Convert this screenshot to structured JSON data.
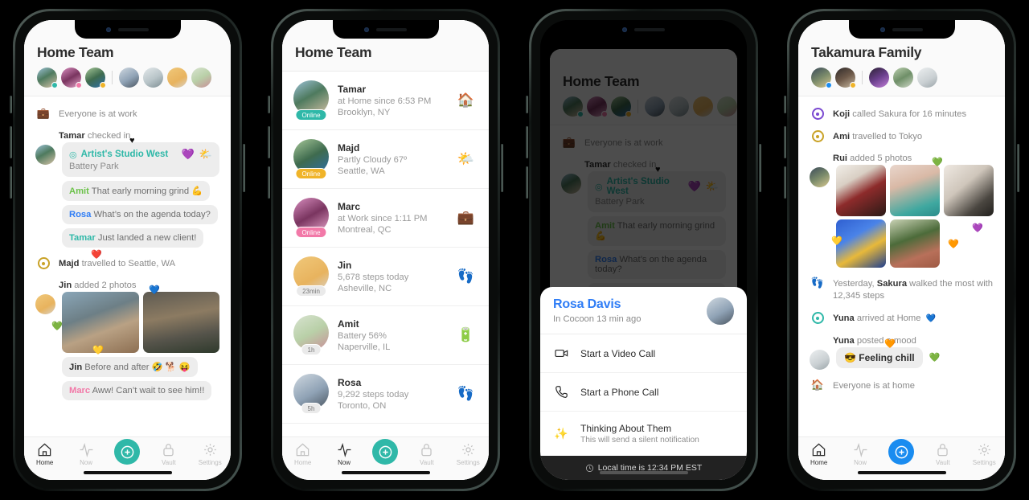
{
  "accent": {
    "teal": "#2fb8a8",
    "blue": "#1a8cf0",
    "yellow": "#f0b429",
    "pink": "#f279a8",
    "purple": "#7b4ad1",
    "green": "#6cc24a"
  },
  "phone1": {
    "header": {
      "title": "Home Team"
    },
    "avatars": [
      {
        "name": "avatar-tamar",
        "dot": "#2fb8a8"
      },
      {
        "name": "avatar-marc",
        "dot": "#f279a8"
      },
      {
        "name": "avatar-majd",
        "dot": "#f0b429"
      },
      {
        "name": "avatar-rosa",
        "dot": ""
      },
      {
        "name": "avatar-amit",
        "dot": ""
      },
      {
        "name": "avatar-jin",
        "dot": ""
      },
      {
        "name": "avatar-yuna",
        "dot": ""
      }
    ],
    "status_work": {
      "icon": "briefcase-emoji",
      "glyph": "💼",
      "text": "Everyone is at work"
    },
    "checkin": {
      "label_name": "Tamar",
      "label_rest": " checked in",
      "place": "Artist's Studio West",
      "sub": "Battery Park",
      "pin_icon": "location-pin-icon",
      "reaction_purple": "💜",
      "weather": "🌤️",
      "heart_black": "♥"
    },
    "messages": [
      {
        "who": "Amit",
        "color": "#6cc24a",
        "text": " That early morning grind 💪"
      },
      {
        "who": "Rosa",
        "color": "#2f7df6",
        "text": " What’s on the agenda today?"
      },
      {
        "who": "Tamar",
        "color": "#2fb8a8",
        "text": " Just landed a new client!"
      }
    ],
    "travel": {
      "who": "Majd",
      "text": " travelled to Seattle, WA",
      "heart": "❤️"
    },
    "photos_label": {
      "who": "Jin",
      "text": " added 2 photos"
    },
    "photo_hearts": {
      "blue": "💙",
      "teal": "💚",
      "yellow": "💛"
    },
    "messages2": [
      {
        "who": "Jin",
        "color": "#2d2d2d",
        "text": " Before and after 🤣 🐕 😝"
      },
      {
        "who": "Marc",
        "color": "#f279a8",
        "text": " Aww! Can’t wait to see him!!"
      }
    ],
    "tabs": [
      {
        "label": "Home",
        "icon": "home-icon",
        "active": true
      },
      {
        "label": "Now",
        "icon": "pulse-icon",
        "active": false
      },
      {
        "label": "",
        "icon": "plus-circle-icon",
        "fab": true,
        "color": "#2fb8a8"
      },
      {
        "label": "Vault",
        "icon": "lock-icon",
        "active": false
      },
      {
        "label": "Settings",
        "icon": "gear-icon",
        "active": false
      }
    ]
  },
  "phone2": {
    "header": {
      "title": "Home Team"
    },
    "rows": [
      {
        "name": "Tamar",
        "line1": "at Home since 6:53 PM",
        "line2": "Brooklyn, NY",
        "badge": "Online",
        "badge_color": "#2fb8a8",
        "emoji": "🏠",
        "emoji_name": "house-emoji",
        "avatar": "av1"
      },
      {
        "name": "Majd",
        "line1": "Partly Cloudy 67º",
        "line2": "Seattle, WA",
        "badge": "Online",
        "badge_color": "#f0b429",
        "emoji": "🌤️",
        "emoji_name": "partly-cloudy-emoji",
        "avatar": "av3"
      },
      {
        "name": "Marc",
        "line1": "at Work since 1:11 PM",
        "line2": "Montreal, QC",
        "badge": "Online",
        "badge_color": "#f279a8",
        "emoji": "💼",
        "emoji_name": "briefcase-emoji",
        "avatar": "av2"
      },
      {
        "name": "Jin",
        "line1": "5,678 steps today",
        "line2": "Asheville, NC",
        "badge": "23min",
        "badge_color": "",
        "emoji": "👣",
        "emoji_name": "footprints-emoji",
        "avatar": "av6"
      },
      {
        "name": "Amit",
        "line1": "Battery 56%",
        "line2": "Naperville, IL",
        "badge": "1h",
        "badge_color": "",
        "emoji": "🔋",
        "emoji_name": "battery-emoji",
        "avatar": "av7"
      },
      {
        "name": "Rosa",
        "line1": "9,292 steps today",
        "line2": "Toronto, ON",
        "badge": "5h",
        "badge_color": "",
        "emoji": "👣",
        "emoji_name": "footprints-emoji",
        "avatar": "av4"
      }
    ],
    "tabs": [
      {
        "label": "Home",
        "icon": "home-icon",
        "active": false
      },
      {
        "label": "Now",
        "icon": "pulse-icon",
        "active": true
      },
      {
        "label": "",
        "icon": "plus-circle-icon",
        "fab": true,
        "color": "#2fb8a8"
      },
      {
        "label": "Vault",
        "icon": "lock-icon",
        "active": false
      },
      {
        "label": "Settings",
        "icon": "gear-icon",
        "active": false
      }
    ]
  },
  "phone3": {
    "background_title": "Home Team",
    "sheet": {
      "name": "Rosa Davis",
      "sub": "In Cocoon 13 min ago",
      "avatar_name": "avatar-rosa",
      "items": [
        {
          "label": "Start a Video Call",
          "note": "",
          "icon": "video-camera-icon"
        },
        {
          "label": "Start a Phone Call",
          "note": "",
          "icon": "phone-icon"
        },
        {
          "label": "Thinking About Them",
          "note": "This will send a silent notification",
          "icon": "sparkles-icon",
          "emoji": "✨"
        }
      ],
      "footer": {
        "icon": "clock-icon",
        "text": "Local time is 12:34 PM EST"
      }
    }
  },
  "phone4": {
    "header": {
      "title": "Takamura Family"
    },
    "avatars": [
      {
        "name": "avatar-rui",
        "dot": "#1a8cf0"
      },
      {
        "name": "avatar-sakura",
        "dot": "#f0b429"
      },
      {
        "name": "avatar-koji",
        "dot": ""
      },
      {
        "name": "avatar-ami",
        "dot": ""
      },
      {
        "name": "avatar-yuna",
        "dot": ""
      }
    ],
    "events": [
      {
        "type": "ring-purple",
        "who": "Koji",
        "text": " called Sakura for 16 minutes",
        "icon": "activity-ring-icon"
      },
      {
        "type": "ring-yellow",
        "who": "Ami",
        "text": " travelled to Tokyo",
        "icon": "activity-ring-icon"
      }
    ],
    "photos_label": {
      "who": "Rui",
      "text": " added 5 photos"
    },
    "photo_hearts": {
      "teal": "💚",
      "purple": "💜",
      "yellow": "💛",
      "orange": "🧡"
    },
    "steps": {
      "icon": "footprints-emoji",
      "glyph": "👣",
      "pre": "Yesterday, ",
      "who": "Sakura",
      "post": " walked the most with 12,345 steps"
    },
    "arrived": {
      "type": "ring-teal",
      "who": "Yuna",
      "text": " arrived at Home",
      "heart": "💙",
      "icon": "activity-ring-icon"
    },
    "mood_label": {
      "who": "Yuna",
      "text": " posted a mood"
    },
    "mood": {
      "emoji": "😎",
      "text": "Feeling chill",
      "heart_teal": "💚",
      "heart_orange": "🧡"
    },
    "home_status": {
      "glyph": "🏠",
      "icon": "house-emoji",
      "text": "Everyone is at home"
    },
    "tabs": [
      {
        "label": "Home",
        "icon": "home-icon",
        "active": true
      },
      {
        "label": "Now",
        "icon": "pulse-icon",
        "active": false
      },
      {
        "label": "",
        "icon": "plus-circle-icon",
        "fab": true,
        "color": "#1a8cf0"
      },
      {
        "label": "Vault",
        "icon": "lock-icon",
        "active": false
      },
      {
        "label": "Settings",
        "icon": "gear-icon",
        "active": false
      }
    ]
  }
}
